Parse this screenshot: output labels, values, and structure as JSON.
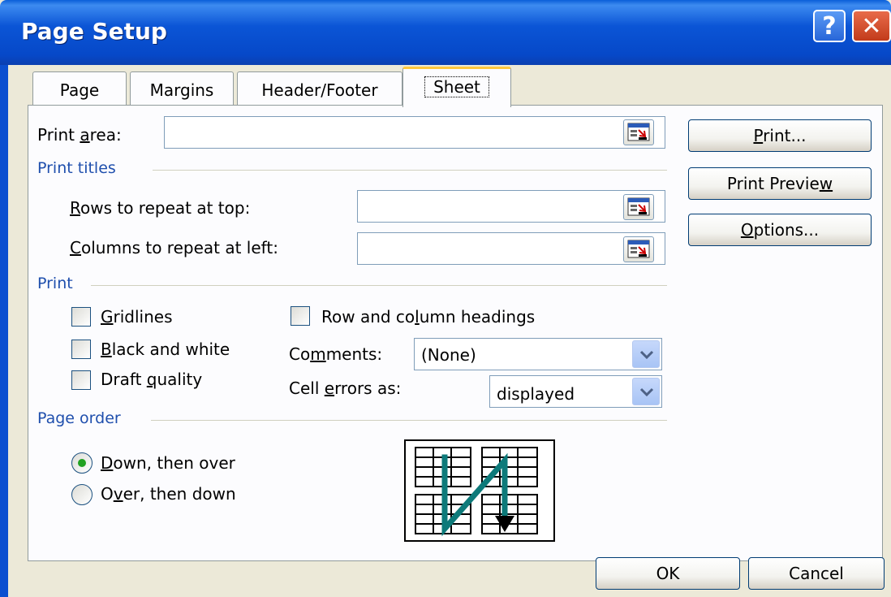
{
  "window": {
    "title": "Page Setup",
    "help_glyph": "?",
    "close_glyph": "✕"
  },
  "tabs": [
    {
      "label": "Page",
      "active": false
    },
    {
      "label": "Margins",
      "active": false
    },
    {
      "label": "Header/Footer",
      "active": false
    },
    {
      "label": "Sheet",
      "active": true
    }
  ],
  "print_area": {
    "label_pre": "Print ",
    "label_u": "a",
    "label_post": "rea:",
    "value": ""
  },
  "print_titles": {
    "section": "Print titles",
    "rows": {
      "label_u": "R",
      "label_post": "ows to repeat at top:",
      "value": ""
    },
    "cols": {
      "label_u": "C",
      "label_post": "olumns to repeat at left:",
      "value": ""
    }
  },
  "print": {
    "section": "Print",
    "gridlines": {
      "label_u": "G",
      "label_post": "ridlines",
      "checked": false
    },
    "black_white": {
      "label_u": "B",
      "label_post": "lack and white",
      "checked": false
    },
    "draft": {
      "label_pre": "Draft ",
      "label_u": "q",
      "label_post": "uality",
      "checked": false
    },
    "row_col_headings": {
      "label_pre": "Row and co",
      "label_u": "l",
      "label_post": "umn headings",
      "checked": false
    },
    "comments": {
      "label_pre": "Co",
      "label_u": "m",
      "label_post": "ments:",
      "value": "(None)"
    },
    "cell_errors": {
      "label_pre": "Cell ",
      "label_u": "e",
      "label_post": "rrors as:",
      "value": "displayed"
    }
  },
  "page_order": {
    "section": "Page order",
    "down_over": {
      "label_u": "D",
      "label_post": "own, then over",
      "selected": true
    },
    "over_down": {
      "label_pre": "O",
      "label_u": "v",
      "label_post": "er, then down",
      "selected": false
    }
  },
  "side_buttons": {
    "print": {
      "label_u": "P",
      "label_post": "rint..."
    },
    "preview": {
      "label_pre": "Print Previe",
      "label_u": "w"
    },
    "options": {
      "label_u": "O",
      "label_post": "ptions..."
    }
  },
  "footer": {
    "ok": "OK",
    "cancel": "Cancel"
  },
  "colors": {
    "titlebar": "#0b55d6",
    "section_text": "#1f4fad",
    "radio_dot": "#21a121",
    "active_tab_accent": "#ffc83c"
  }
}
